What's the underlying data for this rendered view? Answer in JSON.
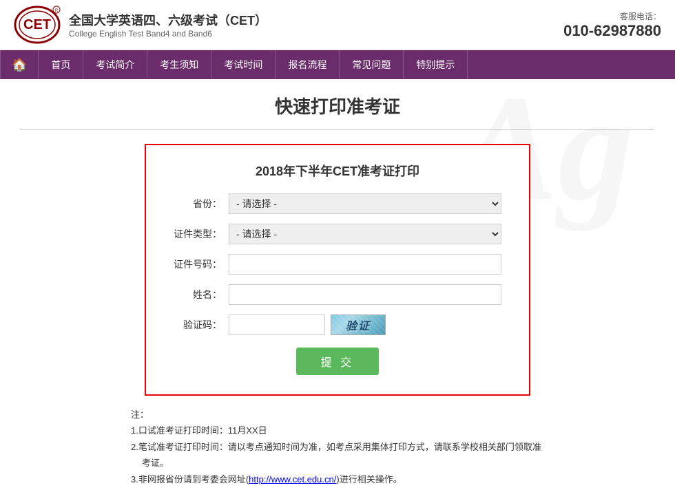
{
  "header": {
    "logo_text": "CET",
    "title_main": "全国大学英语四、六级考试（CET）",
    "title_sub": "College English Test Band4 and Band6",
    "service_label": "客服电话：",
    "service_phone": "010-62987880"
  },
  "nav": {
    "items": [
      {
        "label": "🏠",
        "id": "home"
      },
      {
        "label": "首页",
        "id": "index"
      },
      {
        "label": "考试简介",
        "id": "intro"
      },
      {
        "label": "考生须知",
        "id": "notice"
      },
      {
        "label": "考试时间",
        "id": "time"
      },
      {
        "label": "报名流程",
        "id": "register"
      },
      {
        "label": "常见问题",
        "id": "faq"
      },
      {
        "label": "特别提示",
        "id": "tips"
      }
    ]
  },
  "page": {
    "title": "快速打印准考证",
    "bg_letter": "Ag"
  },
  "form": {
    "title": "2018年下半年CET准考证打印",
    "province_label": "省份：",
    "province_placeholder": "- 请选择 -",
    "cert_type_label": "证件类型：",
    "cert_type_placeholder": "- 请选择 -",
    "cert_no_label": "证件号码：",
    "cert_no_placeholder": "",
    "name_label": "姓名：",
    "name_placeholder": "",
    "captcha_label": "验证码：",
    "captcha_value": "",
    "captcha_display": "验证",
    "submit_label": "提 交"
  },
  "notes": {
    "prefix": "注：",
    "items": [
      "1.口试准考证打印时间：11月XX日",
      "2.笔试准考证打印时间：请以考点通知时间为准，如考点采用集体打印方式，请联系学校相关部门领取准考证。",
      "3.非网报省份请到考委会网址(http://www.cet.edu.cn/)进行相关操作。"
    ],
    "link_text": "http://www.cet.edu.cn/",
    "link_href": "http://www.cet.edu.cn/"
  }
}
